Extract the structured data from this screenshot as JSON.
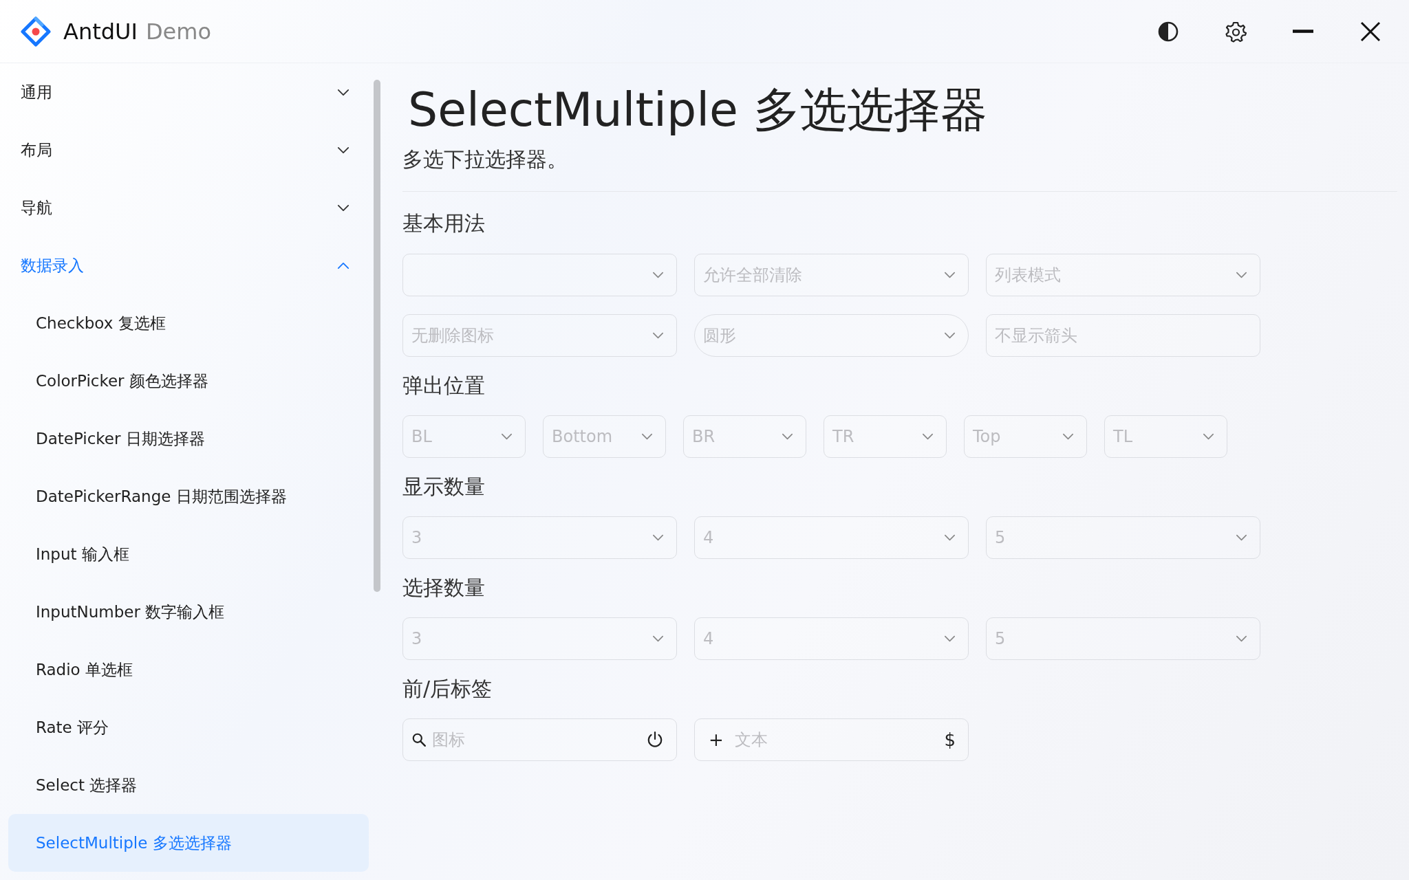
{
  "window": {
    "title": "AntdUI",
    "subtitle": "Demo"
  },
  "sidebar": {
    "items": [
      {
        "label": "通用",
        "expanded": false,
        "selected": false
      },
      {
        "label": "布局",
        "expanded": false,
        "selected": false
      },
      {
        "label": "导航",
        "expanded": false,
        "selected": false
      },
      {
        "label": "数据录入",
        "expanded": true,
        "selected": true,
        "children": [
          {
            "label": "Checkbox 复选框",
            "selected": false
          },
          {
            "label": "ColorPicker 颜色选择器",
            "selected": false
          },
          {
            "label": "DatePicker 日期选择器",
            "selected": false
          },
          {
            "label": "DatePickerRange 日期范围选择器",
            "selected": false
          },
          {
            "label": "Input 输入框",
            "selected": false
          },
          {
            "label": "InputNumber 数字输入框",
            "selected": false
          },
          {
            "label": "Radio 单选框",
            "selected": false
          },
          {
            "label": "Rate 评分",
            "selected": false
          },
          {
            "label": "Select 选择器",
            "selected": false
          },
          {
            "label": "SelectMultiple 多选选择器",
            "selected": true
          }
        ]
      }
    ]
  },
  "page": {
    "title": "SelectMultiple 多选选择器",
    "description": "多选下拉选择器。",
    "sections": [
      {
        "heading": "基本用法",
        "rows": [
          [
            {
              "kind": "select",
              "arrow": true,
              "round": false
            },
            {
              "kind": "select",
              "placeholder": "允许全部清除",
              "arrow": true,
              "round": false
            },
            {
              "kind": "select",
              "placeholder": "列表模式",
              "arrow": true,
              "round": false
            }
          ],
          [
            {
              "kind": "select",
              "placeholder": "无删除图标",
              "arrow": true,
              "round": false
            },
            {
              "kind": "select",
              "placeholder": "圆形",
              "arrow": true,
              "round": true
            },
            {
              "kind": "select",
              "placeholder": "不显示箭头",
              "arrow": false,
              "round": false
            }
          ]
        ]
      },
      {
        "heading": "弹出位置",
        "rows": [
          [
            {
              "kind": "select",
              "placeholder": "BL",
              "arrow": true,
              "round": false
            },
            {
              "kind": "select",
              "placeholder": "Bottom",
              "arrow": true,
              "round": false
            },
            {
              "kind": "select",
              "placeholder": "BR",
              "arrow": true,
              "round": false
            },
            {
              "kind": "select",
              "placeholder": "TR",
              "arrow": true,
              "round": false
            },
            {
              "kind": "select",
              "placeholder": "Top",
              "arrow": true,
              "round": false
            },
            {
              "kind": "select",
              "placeholder": "TL",
              "arrow": true,
              "round": false
            }
          ]
        ]
      },
      {
        "heading": "显示数量",
        "rows": [
          [
            {
              "kind": "select",
              "placeholder": "3",
              "arrow": true,
              "round": false
            },
            {
              "kind": "select",
              "placeholder": "4",
              "arrow": true,
              "round": false
            },
            {
              "kind": "select",
              "placeholder": "5",
              "arrow": true,
              "round": false
            }
          ]
        ]
      },
      {
        "heading": "选择数量",
        "rows": [
          [
            {
              "kind": "select",
              "placeholder": "3",
              "arrow": true,
              "round": false
            },
            {
              "kind": "select",
              "placeholder": "4",
              "arrow": true,
              "round": false
            },
            {
              "kind": "select",
              "placeholder": "5",
              "arrow": true,
              "round": false
            }
          ]
        ]
      },
      {
        "heading": "前/后标签",
        "rows": [
          [
            {
              "kind": "icon_addons",
              "placeholder": "图标"
            },
            {
              "kind": "text_addons",
              "placeholder": "文本",
              "prefix": "+",
              "suffix": "$"
            }
          ]
        ]
      }
    ]
  }
}
